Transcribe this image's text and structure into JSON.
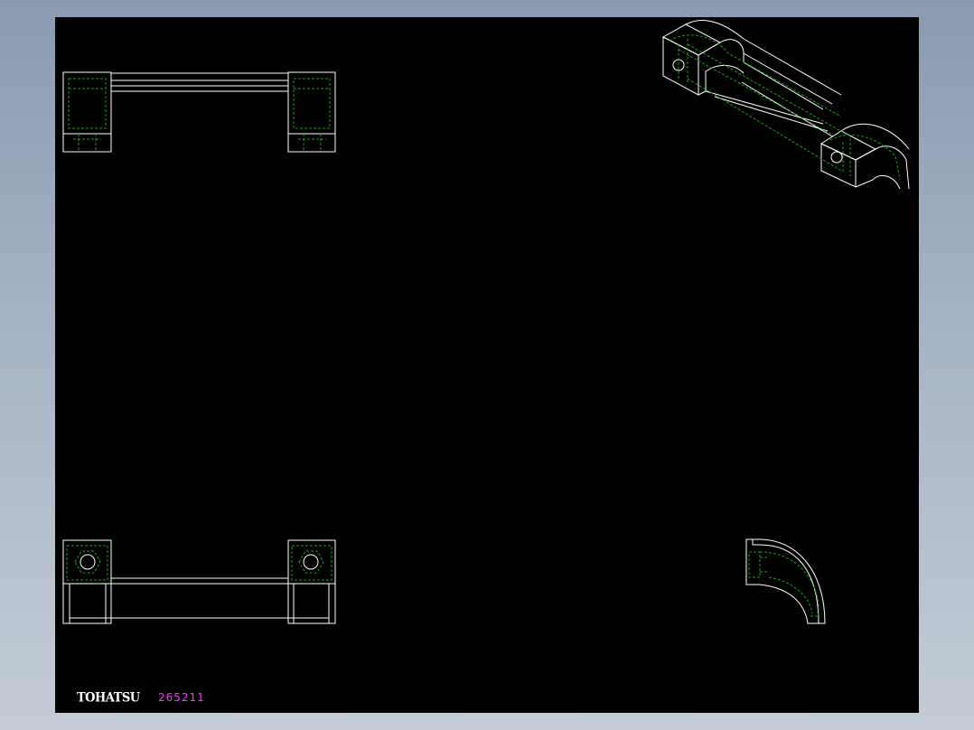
{
  "title_block": {
    "brand": "TOHATSU",
    "part_number": "265211"
  },
  "colors": {
    "background": "#000000",
    "outline": "#ffffff",
    "hidden_lines": "#19a319",
    "part_number_text": "#ff33ff",
    "frame": "#8a9ab0"
  }
}
